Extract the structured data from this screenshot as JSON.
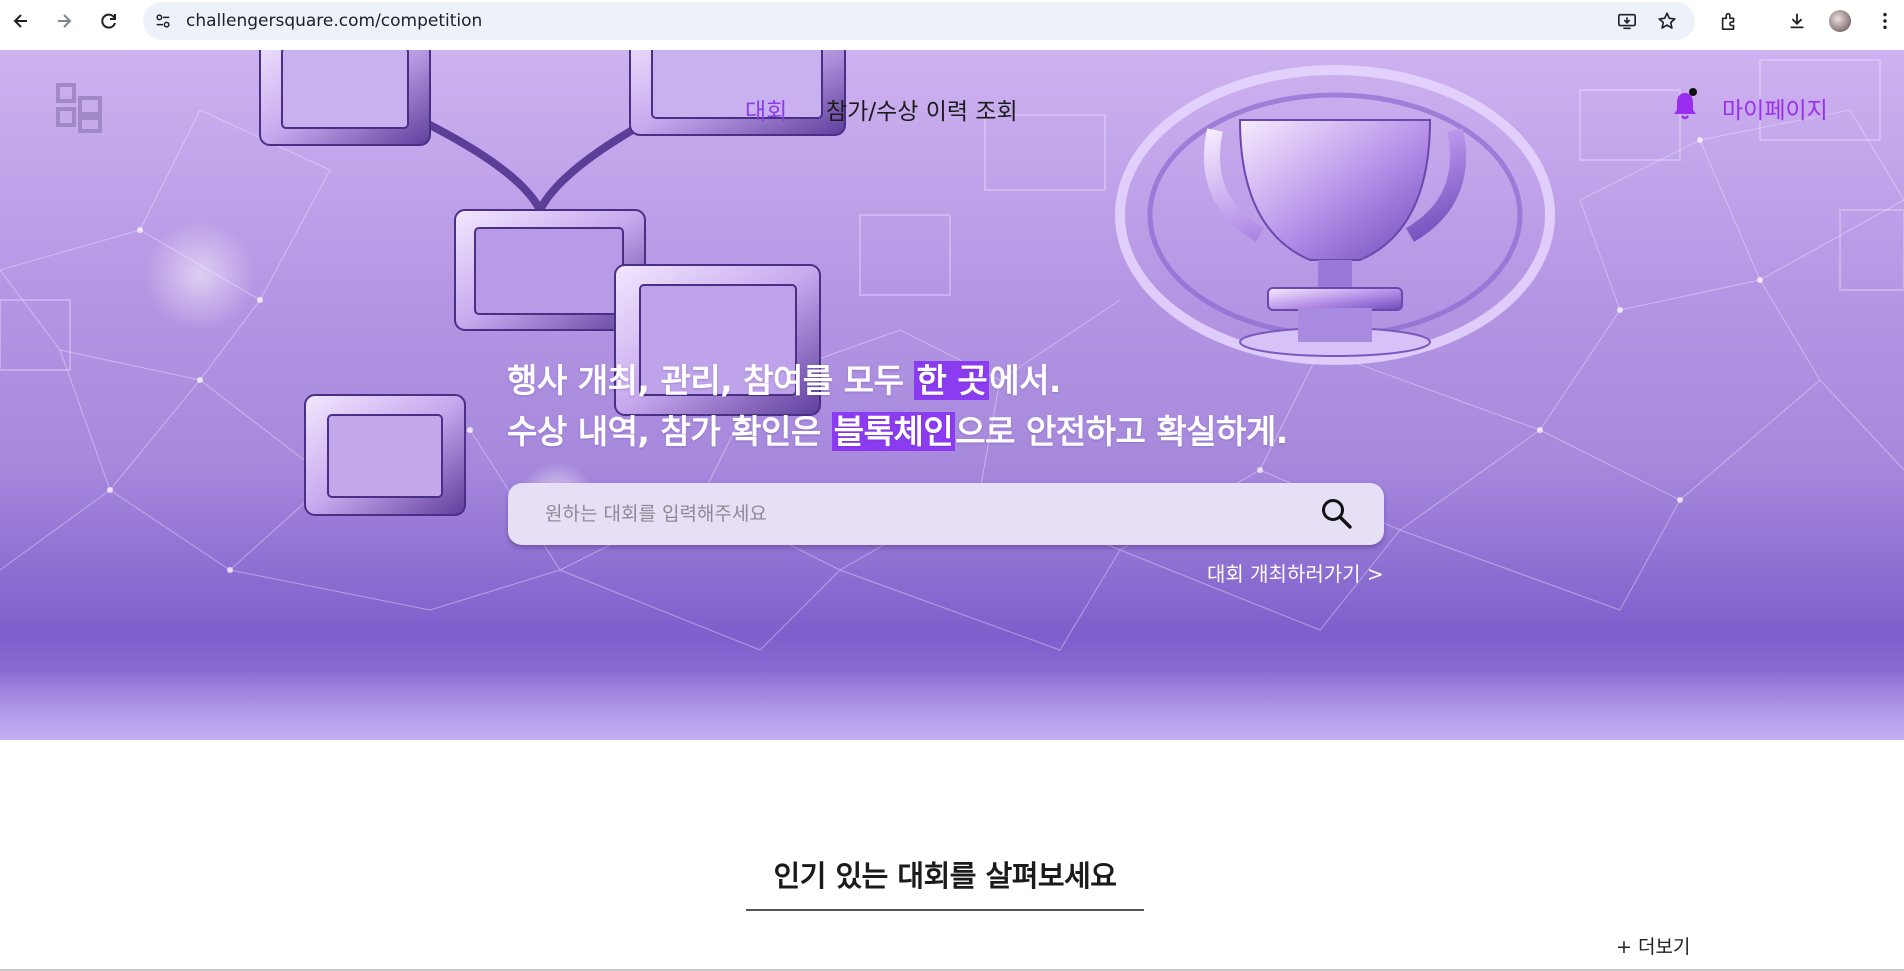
{
  "browser": {
    "url": "challengersquare.com/competition",
    "icons": [
      "back-icon",
      "forward-icon",
      "reload-icon",
      "site-info-icon",
      "install-app-icon",
      "bookmark-star-icon",
      "extensions-icon",
      "download-icon",
      "profile-avatar",
      "menu-dots-icon"
    ]
  },
  "nav": {
    "competition": "대회",
    "history": "참가/수상 이력 조회",
    "mypage": "마이페이지"
  },
  "hero": {
    "line1_before": "행사 개최, 관리, 참여를 모두 ",
    "line1_highlight": "한 곳",
    "line1_after": "에서.",
    "line2_before": "수상 내역, 참가 확인은 ",
    "line2_highlight": "블록체인",
    "line2_after": "으로 안전하고 확실하게.",
    "search_placeholder": "원하는 대회를 입력해주세요",
    "host_link": "대회 개최하러가기 >"
  },
  "popular": {
    "title": "인기 있는 대회를 살펴보세요",
    "more": "+ 더보기"
  },
  "colors": {
    "accent": "#8e3cf0",
    "mypage": "#9c2ef0",
    "highlight_bg": "#8b3cf0"
  }
}
